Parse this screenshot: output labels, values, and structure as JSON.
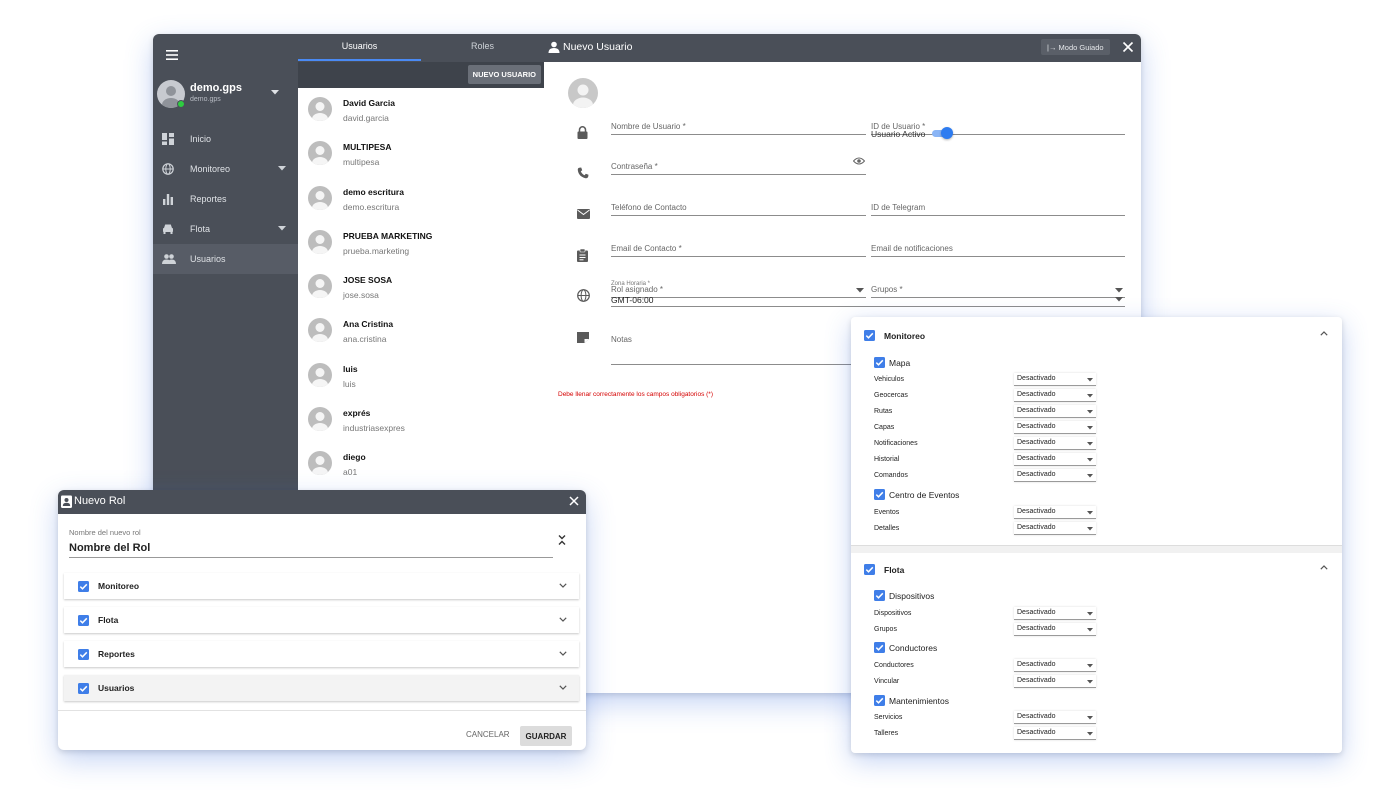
{
  "sidebar": {
    "username": "demo.gps",
    "user_subtitle": "demo.gps",
    "items": [
      {
        "label": "Inicio",
        "icon": "dashboard-icon"
      },
      {
        "label": "Monitoreo",
        "icon": "globe-icon"
      },
      {
        "label": "Reportes",
        "icon": "bar-chart-icon"
      },
      {
        "label": "Flota",
        "icon": "car-icon"
      },
      {
        "label": "Usuarios",
        "icon": "people-icon"
      }
    ]
  },
  "user_panel": {
    "tabs": [
      "Usuarios",
      "Roles"
    ],
    "new_user_button": "NUEVO USUARIO",
    "users": [
      {
        "name": "David Garcia",
        "username": "david.garcia"
      },
      {
        "name": "MULTIPESA",
        "username": "multipesa"
      },
      {
        "name": "demo escritura",
        "username": "demo.escritura"
      },
      {
        "name": "PRUEBA MARKETING",
        "username": "prueba.marketing"
      },
      {
        "name": "JOSE SOSA",
        "username": "jose.sosa"
      },
      {
        "name": "Ana Cristina",
        "username": "ana.cristina"
      },
      {
        "name": "luis",
        "username": "luis"
      },
      {
        "name": "exprés",
        "username": "industriasexpres"
      },
      {
        "name": "diego",
        "username": "a01"
      }
    ]
  },
  "user_form": {
    "title": "Nuevo Usuario",
    "guided_button": "|→ Modo Guiado",
    "fields": {
      "username": "Nombre de Usuario *",
      "user_id": "ID de Usuario *",
      "password": "Contraseña *",
      "active_label": "Usuario Activo",
      "phone": "Teléfono de Contacto",
      "telegram": "ID de Telegram",
      "email": "Email de Contacto *",
      "notify_email": "Email de notificaciones",
      "role": "Rol asignado *",
      "groups": "Grupos *",
      "timezone_label": "Zona Horaria *",
      "timezone_value": "GMT-06:00",
      "notes": "Notas"
    },
    "active": true,
    "error": "Debe llenar correctamente los campos obligatorios (*)"
  },
  "role_dialog": {
    "title": "Nuevo Rol",
    "name_label": "Nombre del nuevo rol",
    "name_value": "Nombre del Rol",
    "sections": [
      "Monitoreo",
      "Flota",
      "Reportes",
      "Usuarios"
    ],
    "cancel": "CANCELAR",
    "save": "GUARDAR"
  },
  "permissions": {
    "option_value": "Desactivado",
    "sections": [
      {
        "label": "Monitoreo",
        "groups": [
          {
            "label": "Mapa",
            "items": [
              "Vehiculos",
              "Geocercas",
              "Rutas",
              "Capas",
              "Notificaciones",
              "Historial",
              "Comandos"
            ]
          },
          {
            "label": "Centro de Eventos",
            "items": [
              "Eventos",
              "Detalles"
            ]
          }
        ]
      },
      {
        "label": "Flota",
        "groups": [
          {
            "label": "Dispositivos",
            "items": [
              "Dispositivos",
              "Grupos"
            ]
          },
          {
            "label": "Conductores",
            "items": [
              "Conductores",
              "Vincular"
            ]
          },
          {
            "label": "Mantenimientos",
            "items": [
              "Servicios",
              "Talleres"
            ]
          }
        ]
      }
    ]
  },
  "colors": {
    "dark_bar": "#4a4f58",
    "accent": "#4a8af4",
    "error": "#d50000"
  }
}
